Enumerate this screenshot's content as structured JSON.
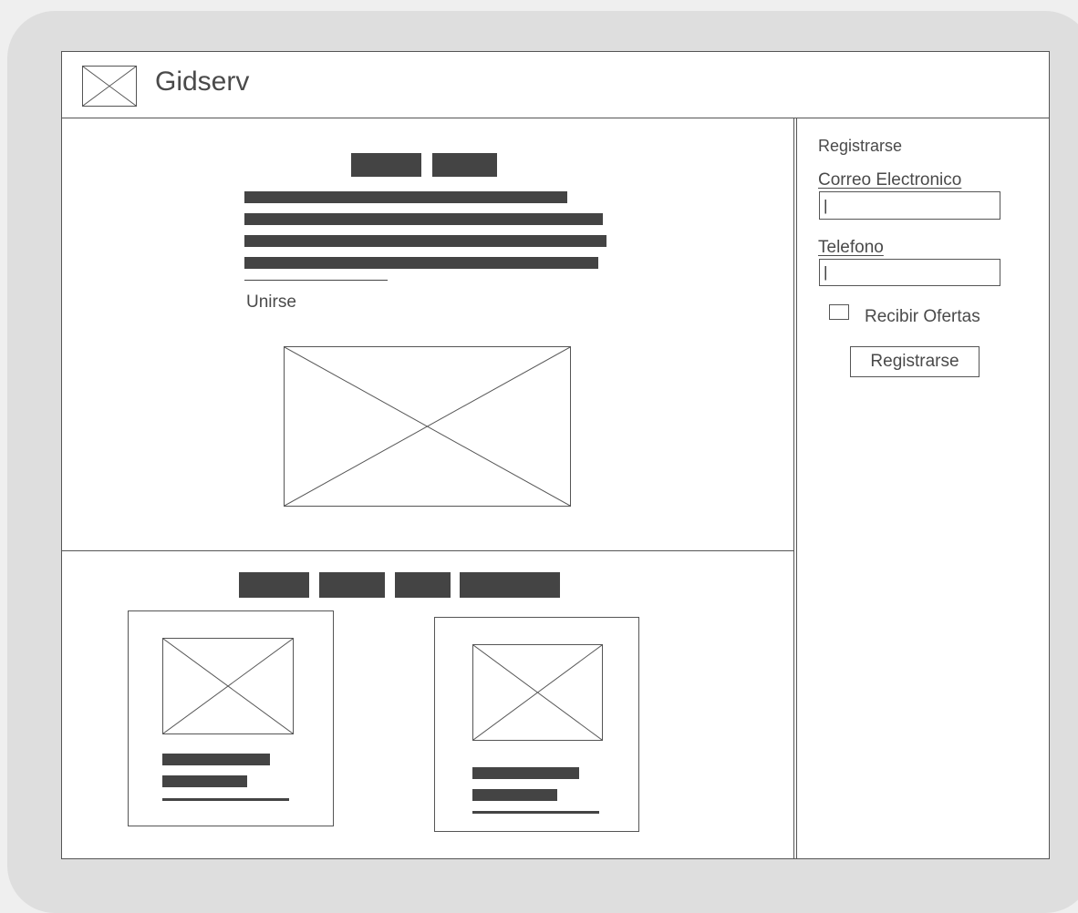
{
  "header": {
    "title": "Gidserv",
    "logo_icon": "image-placeholder-icon"
  },
  "hero": {
    "link_label": "Unirse"
  },
  "signup": {
    "title": "Registrarse",
    "email_label": "Correo Electronico",
    "email_value": "|",
    "phone_label": "Telefono",
    "phone_value": "|",
    "offers_label": "Recibir Ofertas",
    "offers_checked": false,
    "submit_label": "Registrarse"
  },
  "colors": {
    "background": "#efefef",
    "frame": "#dedede",
    "text": "#4a4a4a",
    "placeholder_bar": "#444444",
    "border": "#555555"
  }
}
